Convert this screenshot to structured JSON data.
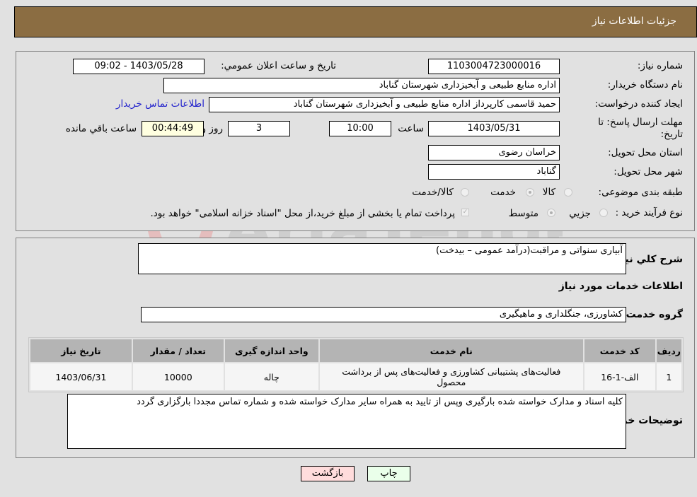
{
  "header": {
    "title": "جزئیات اطلاعات نیاز"
  },
  "form": {
    "need_number": {
      "label": "شماره نیاز:",
      "value": "1103004723000016"
    },
    "announce_datetime": {
      "label": "تاریخ و ساعت اعلان عمومي:",
      "value": "1403/05/28 - 09:02"
    },
    "buyer_org": {
      "label": "نام دستگاه خریدار:",
      "value": "اداره منابع طبیعی و آبخیزداری شهرستان گناباد"
    },
    "requester": {
      "label": "ایجاد کننده درخواست:",
      "value": "حمید قاسمی  کارپرداز اداره منابع طبیعی و آبخیزداری شهرستان گناباد"
    },
    "buyer_contact_link": "اطلاعات تماس خریدار",
    "deadline": {
      "label": "مهلت ارسال پاسخ: تا تاریخ:",
      "date": "1403/05/31",
      "time_label": "ساعت",
      "time": "10:00",
      "days": "3",
      "days_label": "روز و",
      "remaining": "00:44:49",
      "remaining_label": "ساعت باقي مانده"
    },
    "province": {
      "label": "استان محل تحویل:",
      "value": "خراسان رضوی"
    },
    "city": {
      "label": "شهر محل تحویل:",
      "value": "گناباد"
    },
    "category": {
      "label": "طبقه بندی موضوعی:",
      "options": [
        "کالا",
        "خدمت",
        "کالا/خدمت"
      ],
      "selected": "خدمت"
    },
    "purchase_type": {
      "label": "نوع فرآیند خرید :",
      "options": [
        "جزيي",
        "متوسط"
      ],
      "selected": "متوسط",
      "treasury_note": "پرداخت تمام یا بخشی از مبلغ خرید،از محل \"اسناد خزانه اسلامی\" خواهد بود."
    }
  },
  "details": {
    "description_label": "شرح كلي نياز:",
    "description": "آبیاری سنواتی و مراقبت(درآمد عمومی – بیدخت)",
    "services_heading": "اطلاعات خدمات مورد نياز",
    "service_group_label": "گروه خدمت:",
    "service_group": "کشاورزی، جنگلداری و ماهیگیری",
    "table": {
      "headers": [
        "ردیف",
        "کد خدمت",
        "نام خدمت",
        "واحد اندازه گیری",
        "تعداد / مقدار",
        "تاریخ نیاز"
      ],
      "rows": [
        [
          "1",
          "الف-1-16",
          "فعالیت‌های پشتیبانی کشاورزی و فعالیت‌های پس از برداشت محصول",
          "چاله",
          "10000",
          "1403/06/31"
        ]
      ]
    },
    "buyer_notes_label": "توضیحات خریدار:",
    "buyer_notes": "کلیه اسناد و مدارک خواسته شده بارگیری وپس از تایید به همراه سایر مدارک خواسته شده و شماره تماس مجددا بارگزاری گردد"
  },
  "buttons": {
    "print": "چاپ",
    "back": "بازگشت"
  },
  "watermark": "AriaTender.neT",
  "colors": {
    "header_bg": "#8b6d42",
    "print_bg": "#eaffea",
    "back_bg": "#ffdcdc",
    "link": "#2222cc"
  }
}
